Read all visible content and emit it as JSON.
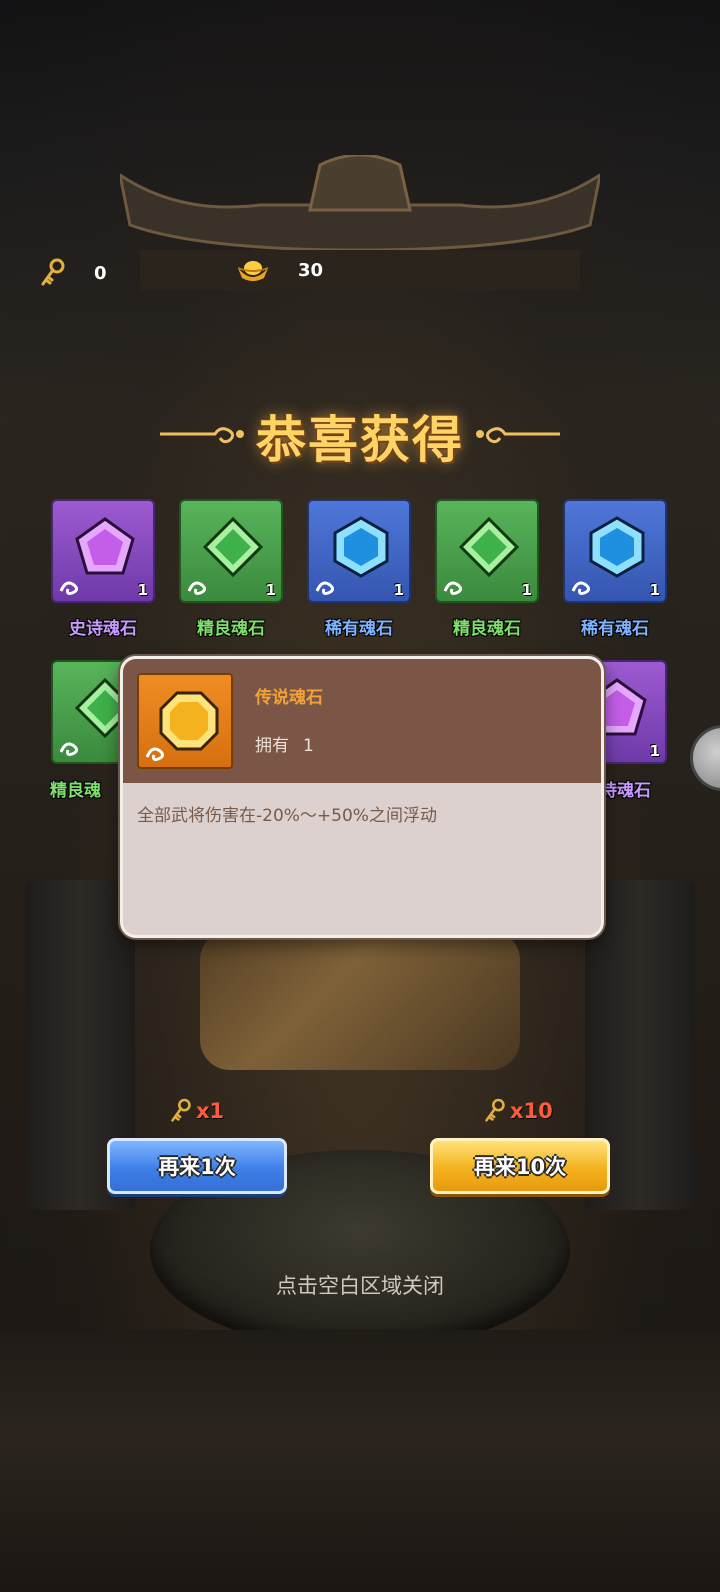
{
  "currencies": {
    "keys": {
      "icon": "key-icon",
      "value": "0"
    },
    "gold": {
      "icon": "gold-ingot-icon",
      "value": "30"
    }
  },
  "title": "恭喜获得",
  "rewards": [
    {
      "name": "史诗魂石",
      "rarity": "purple",
      "quantity": "1",
      "gem": "pentagon-gem-icon"
    },
    {
      "name": "精良魂石",
      "rarity": "green",
      "quantity": "1",
      "gem": "diamond-gem-icon"
    },
    {
      "name": "稀有魂石",
      "rarity": "blue",
      "quantity": "1",
      "gem": "hexagon-gem-icon"
    },
    {
      "name": "精良魂石",
      "rarity": "green",
      "quantity": "1",
      "gem": "diamond-gem-icon"
    },
    {
      "name": "稀有魂石",
      "rarity": "blue",
      "quantity": "1",
      "gem": "hexagon-gem-icon"
    },
    {
      "name": "精良魂",
      "rarity": "green",
      "quantity": "",
      "gem": "diamond-gem-icon"
    },
    {
      "name": "诗魂石",
      "rarity": "purple",
      "quantity": "1",
      "gem": "pentagon-gem-icon"
    }
  ],
  "tooltip": {
    "name": "传说魂石",
    "own_label": "拥有",
    "own_value": "1",
    "description": "全部武将伤害在-20%～+50%之间浮动",
    "rarity": "orange"
  },
  "draw_once": {
    "cost": "x1",
    "label": "再来1次"
  },
  "draw_ten": {
    "cost": "x10",
    "label": "再来10次"
  },
  "close_hint": "点击空白区域关闭",
  "colors": {
    "title": "#ffd466",
    "epic": "#c79aff",
    "fine": "#7ee06a",
    "rare": "#7fb3ff",
    "legend": "#f3a238",
    "cost": "#ff5a3c"
  }
}
